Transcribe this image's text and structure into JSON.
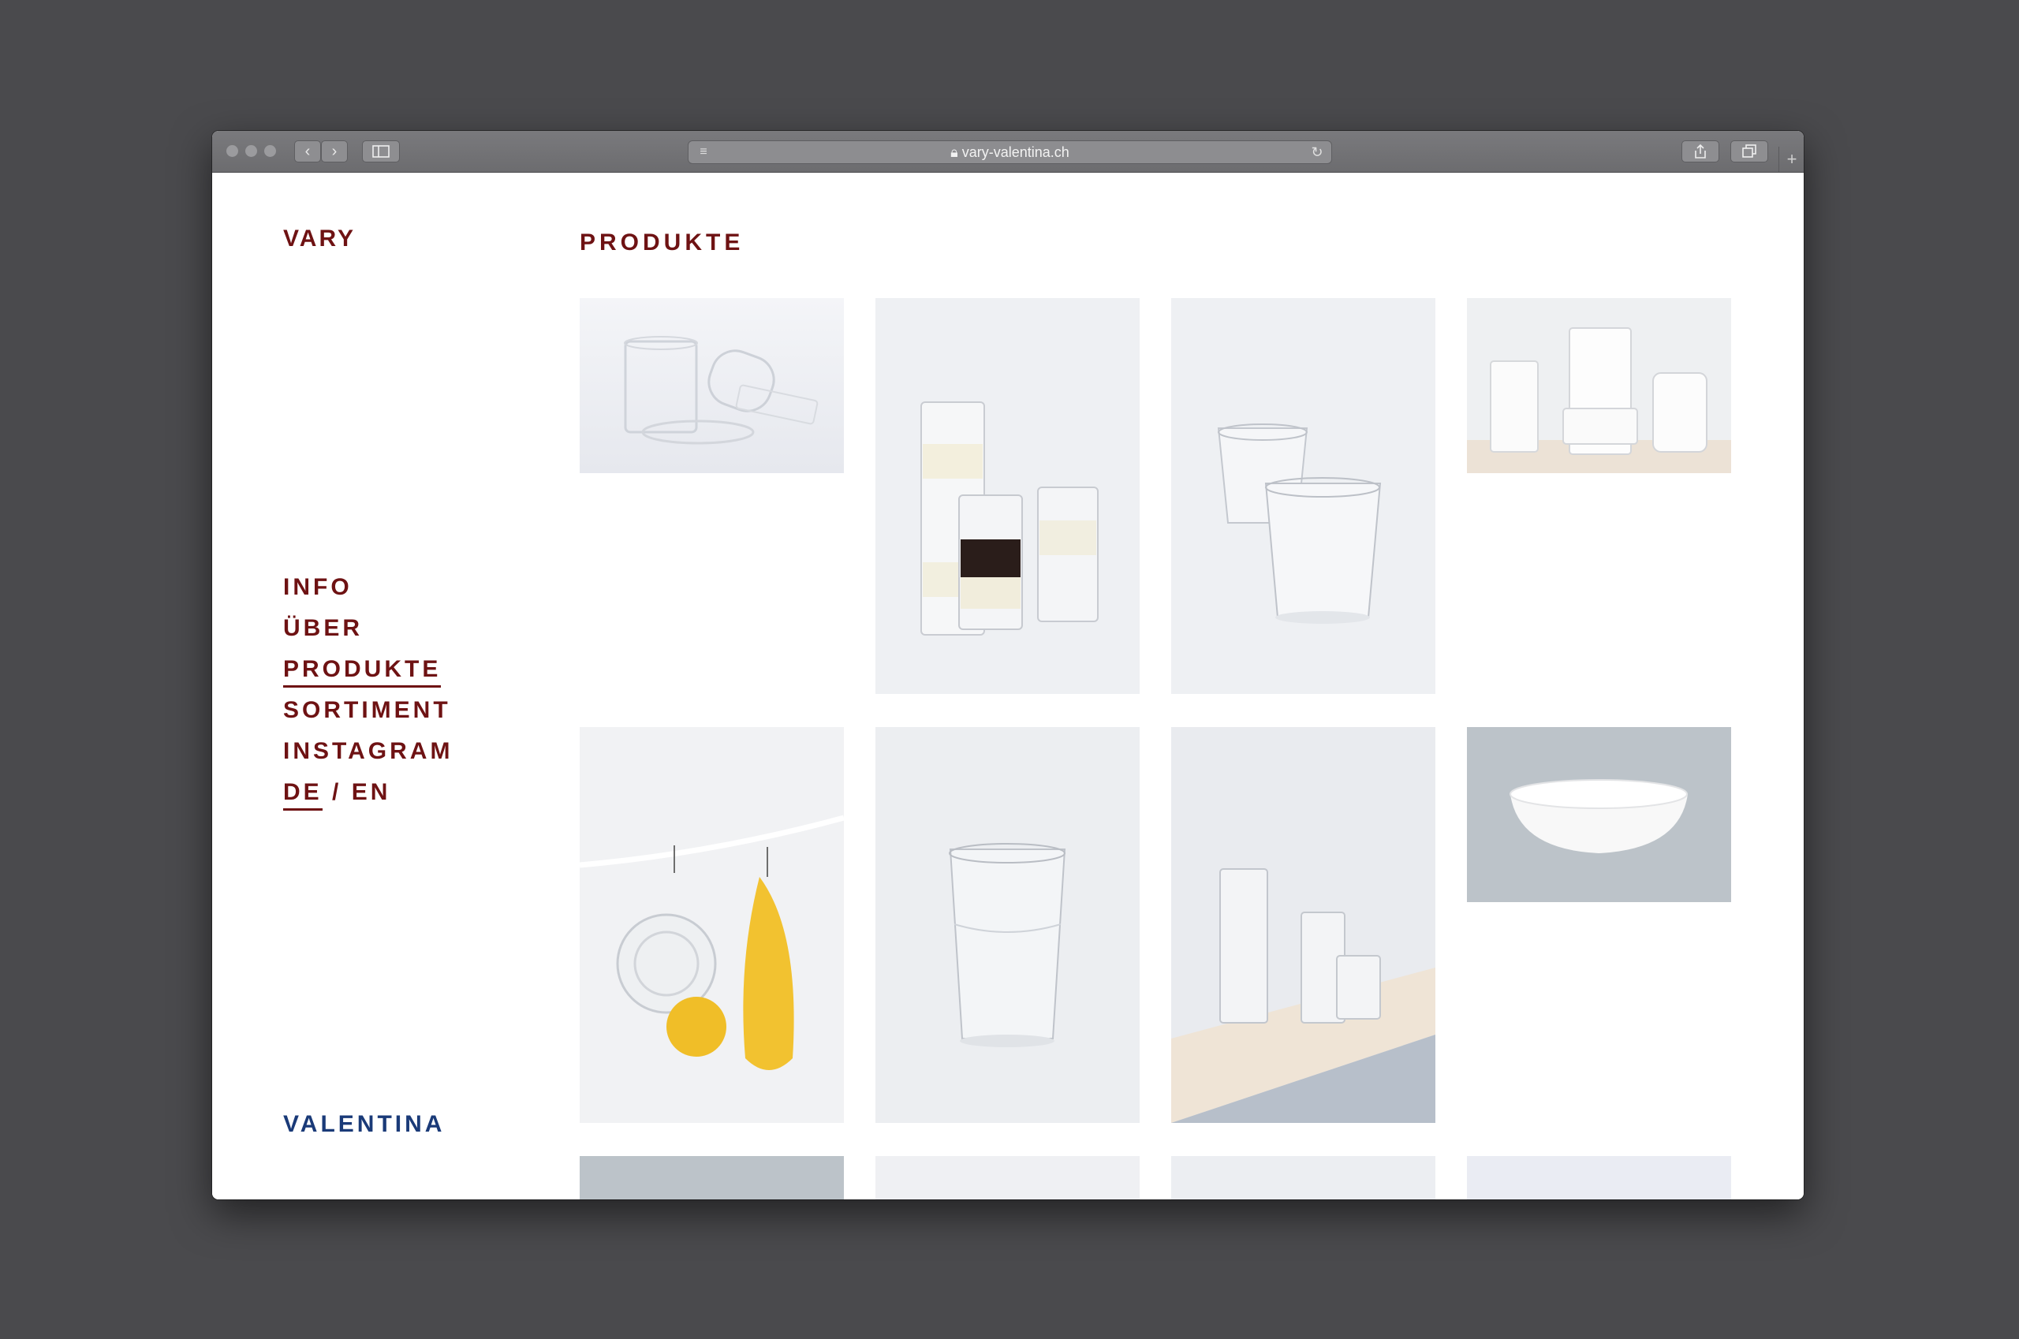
{
  "browser": {
    "url": "vary-valentina.ch"
  },
  "site": {
    "brand_top": "VARY",
    "brand_bottom": "VALENTINA",
    "heading": "PRODUKTE",
    "nav": [
      {
        "label": "INFO"
      },
      {
        "label": "ÜBER"
      },
      {
        "label": "PRODUKTE",
        "active": true
      },
      {
        "label": "SORTIMENT"
      },
      {
        "label": "INSTAGRAM"
      }
    ],
    "lang": {
      "de": "DE",
      "sep": "/",
      "en": "EN",
      "active": "DE"
    }
  },
  "colors": {
    "accent": "#6e1213",
    "brand_blue": "#1a3a78"
  }
}
